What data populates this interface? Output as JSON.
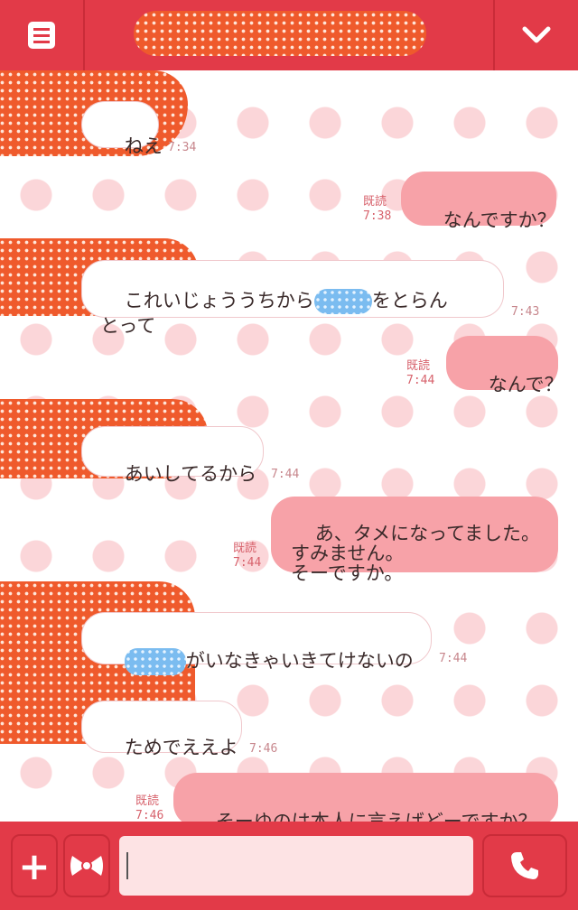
{
  "header": {
    "title": "",
    "menu_icon": "menu-icon",
    "down_icon": "chevron-down-icon"
  },
  "messages": [
    {
      "side": "in",
      "text": "ねえ",
      "time": "7:34"
    },
    {
      "side": "out",
      "text": "なんですか？",
      "read": "既読",
      "time": "7:38"
    },
    {
      "side": "in",
      "text_before": "これいじょううちから",
      "text_after": "をとらん\nとって",
      "time": "7:43"
    },
    {
      "side": "out",
      "text": "なんで？",
      "read": "既読",
      "time": "7:44"
    },
    {
      "side": "in",
      "text": "あいしてるから",
      "time": "7:44"
    },
    {
      "side": "out",
      "text": "あ、タメになってました。\nすみません。\nそーですか。",
      "read": "既読",
      "time": "7:44"
    },
    {
      "side": "in",
      "text_after": "がいなきゃいきてけないの",
      "time": "7:44"
    },
    {
      "side": "in",
      "text": "ためでええよ",
      "time": "7:46"
    },
    {
      "side": "out",
      "text": "そーゆのは本人に言えばどーですか？",
      "read": "既読",
      "time": "7:46"
    }
  ],
  "bottom": {
    "plus": "+",
    "input_value": ""
  },
  "colors": {
    "accent": "#e23a48",
    "outgoing": "#f7a2a8",
    "incoming": "#ffffff",
    "background_dots": "#fbd6d9"
  }
}
